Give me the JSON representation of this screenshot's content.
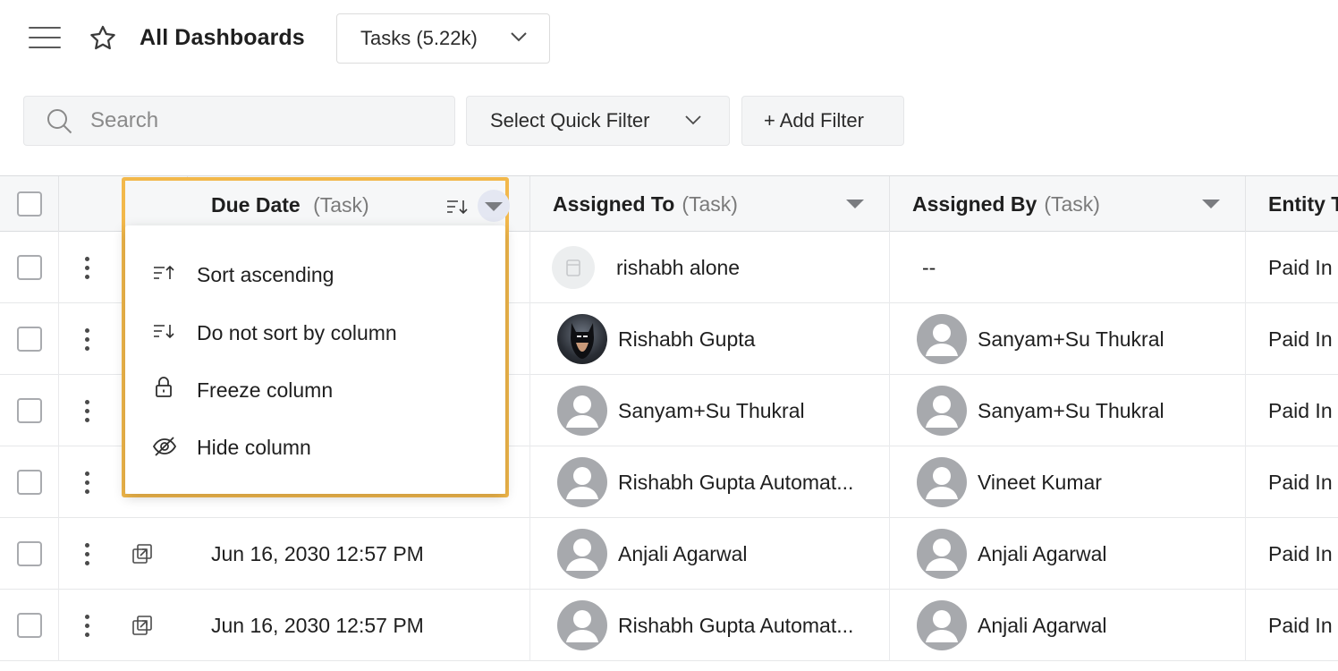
{
  "header": {
    "title": "All Dashboards",
    "dashboard_select": "Tasks (5.22k)"
  },
  "filters": {
    "search_placeholder": "Search",
    "quick_filter_label": "Select Quick Filter",
    "add_filter_label": "+ Add Filter"
  },
  "columns": [
    {
      "name": "Due Date",
      "sub": "(Task)"
    },
    {
      "name": "Assigned To",
      "sub": "(Task)"
    },
    {
      "name": "Assigned By",
      "sub": "(Task)"
    },
    {
      "name": "Entity T",
      "sub": ""
    }
  ],
  "column_menu": {
    "items": [
      {
        "label": "Sort ascending",
        "icon": "sort-ascending-icon"
      },
      {
        "label": "Do not sort by column",
        "icon": "sort-descending-icon"
      },
      {
        "label": "Freeze column",
        "icon": "lock-icon"
      },
      {
        "label": "Hide column",
        "icon": "eye-off-icon"
      }
    ]
  },
  "rows": [
    {
      "due": "",
      "assigned_to": "rishabh alone",
      "assigned_by": "--",
      "entity": "Paid In"
    },
    {
      "due": "",
      "assigned_to": "Rishabh Gupta",
      "assigned_by": "Sanyam+Su Thukral",
      "entity": "Paid In"
    },
    {
      "due": "",
      "assigned_to": "Sanyam+Su Thukral",
      "assigned_by": "Sanyam+Su Thukral",
      "entity": "Paid In"
    },
    {
      "due": "",
      "assigned_to": "Rishabh Gupta Automat...",
      "assigned_by": "Vineet Kumar",
      "entity": "Paid In"
    },
    {
      "due": "Jun 16, 2030 12:57 PM",
      "assigned_to": "Anjali Agarwal",
      "assigned_by": "Anjali Agarwal",
      "entity": "Paid In"
    },
    {
      "due": "Jun 16, 2030 12:57 PM",
      "assigned_to": "Rishabh Gupta Automat...",
      "assigned_by": "Anjali Agarwal",
      "entity": "Paid In"
    }
  ],
  "colors": {
    "highlight_border": "#f2b84b",
    "header_bg": "#f6f7f8",
    "avatar_grey": "#a7a9ad"
  }
}
